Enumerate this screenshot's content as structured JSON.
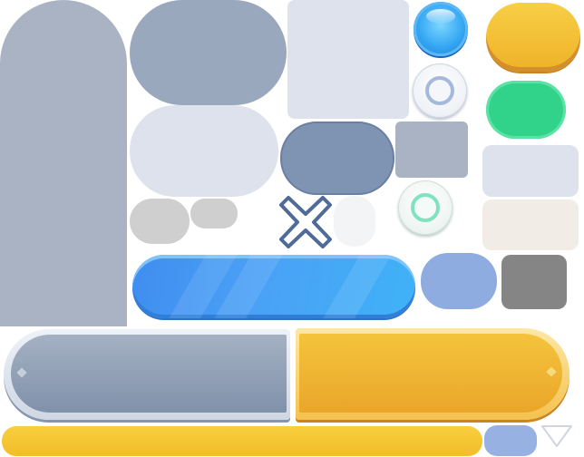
{
  "sheet": {
    "description_items": [
      "panel-tall",
      "panel-pill-dark",
      "panel-square-light",
      "orb-blue",
      "button-yellow-small",
      "radio-gray",
      "button-green",
      "panel-pill-light",
      "pill-blue-slate",
      "square-slate",
      "panel-gray-light",
      "pill-gray-1",
      "pill-gray-2",
      "close-x",
      "pill-white",
      "radio-green",
      "panel-cream",
      "button-blue-wide",
      "pill-periwinkle",
      "square-dark",
      "frame-silver",
      "frame-gold",
      "bar-yellow",
      "pill-periwinkle-small",
      "triangle-down"
    ]
  },
  "colors": {
    "slate": "#a9b3c3",
    "slate_dark": "#9aa8bd",
    "light_panel": "#dde2ec",
    "blue_button": "#4aa1f6",
    "yellow_button": "#f2bd2a",
    "green_button": "#31d38b",
    "close_outline": "#4f6b98",
    "gray_dark": "#858585",
    "periwinkle": "#8eacdf",
    "cream": "#f1ede6"
  },
  "icons": {
    "close": "close-icon",
    "dropdown": "triangle-down-icon",
    "radio_off": "radio-ring-icon",
    "radio_on": "radio-ring-green-icon",
    "orb": "blue-orb-icon"
  }
}
